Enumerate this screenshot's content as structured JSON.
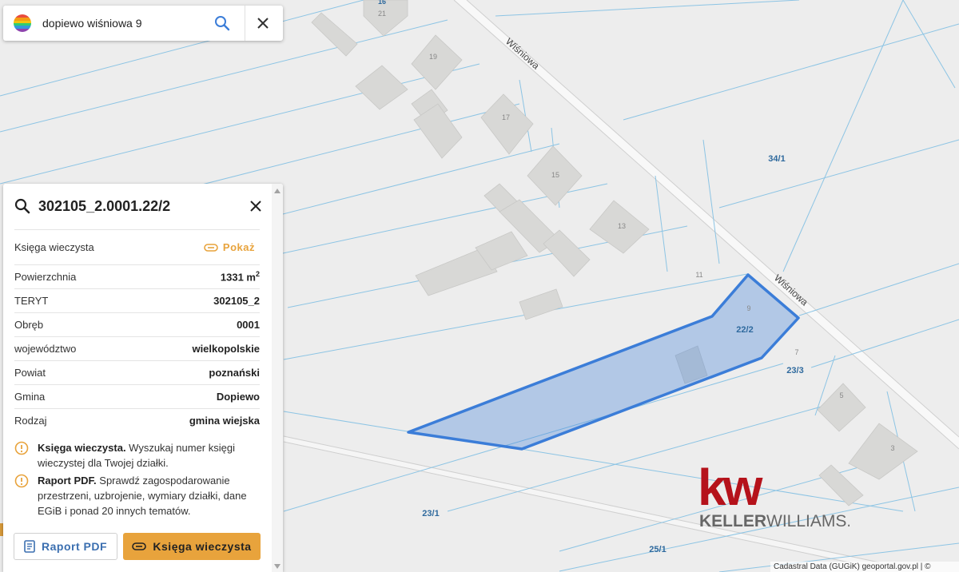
{
  "search": {
    "query": "dopiewo wiśniowa 9"
  },
  "map": {
    "street_labels": [
      "Wiśniowa",
      "Wiśniowa"
    ],
    "house_numbers": [
      "16",
      "21",
      "19",
      "17",
      "15",
      "13",
      "11",
      "9",
      "7",
      "5",
      "3"
    ],
    "parcel_labels": [
      "34/1",
      "22/2",
      "23/3",
      "23/1",
      "25/1"
    ],
    "highlight_color": "#3b7dd8",
    "parcel_line_color": "#8cc4e4",
    "attribution": "Cadastral Data (GUGiK) geoportal.gov.pl | ©"
  },
  "panel": {
    "title": "302105_2.0001.22/2",
    "land_registry": {
      "label": "Księga wieczysta",
      "link": "Pokaż"
    },
    "rows": [
      {
        "label": "Powierzchnia",
        "value": "1331 m",
        "sup": "2"
      },
      {
        "label": "TERYT",
        "value": "302105_2"
      },
      {
        "label": "Obręb",
        "value": "0001"
      },
      {
        "label": "województwo",
        "value": "wielkopolskie"
      },
      {
        "label": "Powiat",
        "value": "poznański"
      },
      {
        "label": "Gmina",
        "value": "Dopiewo"
      },
      {
        "label": "Rodzaj",
        "value": "gmina wiejska"
      }
    ],
    "info": [
      {
        "bold": "Księga wieczysta.",
        "text": " Wyszukaj numer księgi wieczystej dla Twojej działki."
      },
      {
        "bold": "Raport PDF.",
        "text": " Sprawdź zagospodarowanie przestrzeni, uzbrojenie, wymiary działki, dane EGiB i ponad 20 innych tematów."
      }
    ],
    "buttons": {
      "pdf": "Raport PDF",
      "kw": "Księga wieczysta"
    },
    "accent_color": "#e8a33c"
  },
  "watermark": {
    "mark": "kw",
    "name_bold": "KELLER",
    "name_light": "WILLIAMS."
  }
}
